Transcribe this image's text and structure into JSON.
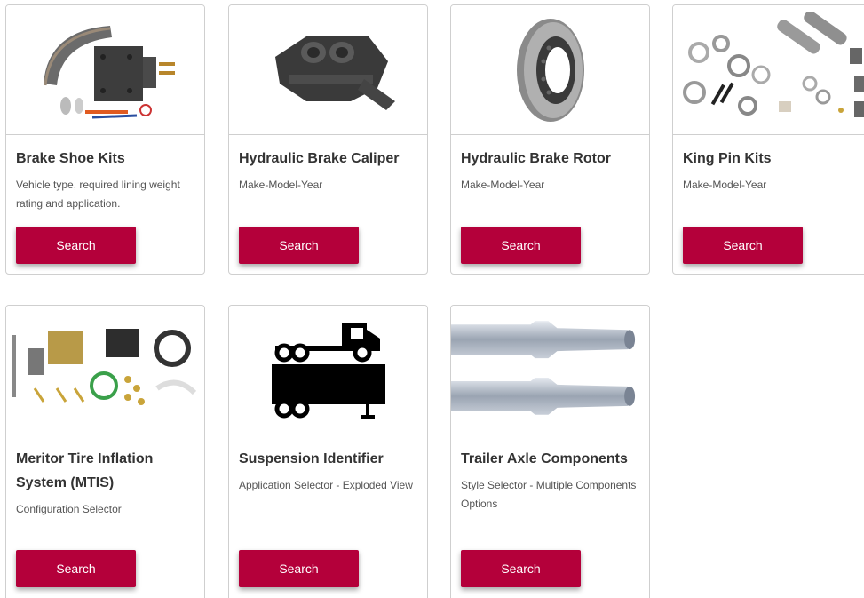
{
  "cards": [
    {
      "title": "Brake Shoe Kits",
      "description": "Vehicle type, required lining weight rating and application.",
      "button": "Search",
      "icon": "brake-shoe-kit-photo"
    },
    {
      "title": "Hydraulic Brake Caliper",
      "description": "Make-Model-Year",
      "button": "Search",
      "icon": "brake-caliper-photo"
    },
    {
      "title": "Hydraulic Brake Rotor",
      "description": "Make-Model-Year",
      "button": "Search",
      "icon": "brake-rotor-photo"
    },
    {
      "title": "King Pin Kits",
      "description": "Make-Model-Year",
      "button": "Search",
      "icon": "king-pin-kit-photo"
    },
    {
      "title": "Meritor Tire Inflation System (MTIS)",
      "description": "Configuration Selector",
      "button": "Search",
      "icon": "tire-inflation-system-photo"
    },
    {
      "title": "Suspension Identifier",
      "description": "Application Selector - Exploded View",
      "button": "Search",
      "icon": "truck-trailer-icon"
    },
    {
      "title": "Trailer Axle Components",
      "description": "Style Selector - Multiple Components Options",
      "button": "Search",
      "icon": "trailer-axle-photo"
    }
  ],
  "colors": {
    "button": "#b4003a",
    "title": "#333333",
    "border": "#cfcfcf"
  }
}
